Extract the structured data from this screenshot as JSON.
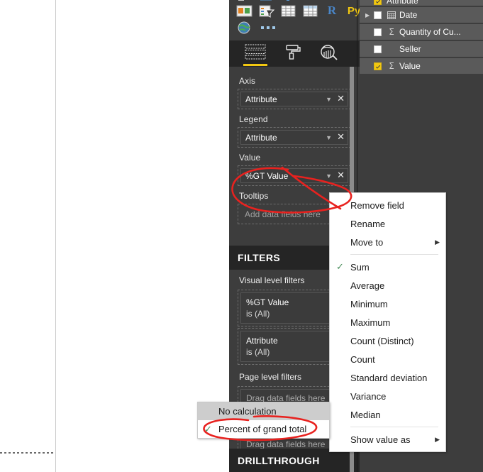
{
  "visualizations": {
    "gallery_icons": [
      "stacked-bar-chart-icon",
      "clustered-column-chart-icon",
      "line-chart-icon",
      "area-chart-icon",
      "card-icon",
      "slicer-funnel-icon",
      "table-icon",
      "matrix-icon",
      "r-script-visual-icon",
      "python-visual-icon",
      "map-globe-icon",
      "more-visuals-icon"
    ],
    "tabs": [
      {
        "name": "fields-tab",
        "label": "Fields",
        "active": true
      },
      {
        "name": "format-tab",
        "label": "Format",
        "active": false
      },
      {
        "name": "analytics-tab",
        "label": "Analytics",
        "active": false
      }
    ],
    "wells": [
      {
        "label": "Axis",
        "field": "Attribute",
        "placeholder": null
      },
      {
        "label": "Legend",
        "field": "Attribute",
        "placeholder": null
      },
      {
        "label": "Value",
        "field": "%GT Value",
        "placeholder": null
      },
      {
        "label": "Tooltips",
        "field": null,
        "placeholder": "Add data fields here"
      }
    ]
  },
  "filters": {
    "header": "FILTERS",
    "visual_level_label": "Visual level filters",
    "visual_filters": [
      {
        "name": "%GT Value",
        "value": "is (All)"
      },
      {
        "name": "Attribute",
        "value": "is (All)"
      }
    ],
    "page_level_label": "Page level filters",
    "page_level_placeholder": "Drag data fields here",
    "report_level_placeholder": "Drag data fields here",
    "drillthrough_header": "DRILLTHROUGH"
  },
  "fields": {
    "items": [
      {
        "label": "Attribute",
        "checked": true,
        "sigma": false,
        "calendar": false,
        "expandable": false,
        "clipped": true
      },
      {
        "label": "Date",
        "checked": false,
        "sigma": false,
        "calendar": true,
        "expandable": true,
        "clipped": false
      },
      {
        "label": "Quantity of Cu...",
        "checked": false,
        "sigma": true,
        "calendar": false,
        "expandable": false,
        "clipped": false
      },
      {
        "label": "Seller",
        "checked": false,
        "sigma": false,
        "calendar": false,
        "expandable": false,
        "clipped": false
      },
      {
        "label": "Value",
        "checked": true,
        "sigma": true,
        "calendar": false,
        "expandable": false,
        "clipped": false
      }
    ]
  },
  "context_menu": {
    "items": [
      {
        "label": "Remove field",
        "checked": false,
        "submenu": false,
        "separator_after": false
      },
      {
        "label": "Rename",
        "checked": false,
        "submenu": false,
        "separator_after": false
      },
      {
        "label": "Move to",
        "checked": false,
        "submenu": true,
        "separator_after": true
      },
      {
        "label": "Sum",
        "checked": true,
        "submenu": false,
        "separator_after": false
      },
      {
        "label": "Average",
        "checked": false,
        "submenu": false,
        "separator_after": false
      },
      {
        "label": "Minimum",
        "checked": false,
        "submenu": false,
        "separator_after": false
      },
      {
        "label": "Maximum",
        "checked": false,
        "submenu": false,
        "separator_after": false
      },
      {
        "label": "Count (Distinct)",
        "checked": false,
        "submenu": false,
        "separator_after": false
      },
      {
        "label": "Count",
        "checked": false,
        "submenu": false,
        "separator_after": false
      },
      {
        "label": "Standard deviation",
        "checked": false,
        "submenu": false,
        "separator_after": false
      },
      {
        "label": "Variance",
        "checked": false,
        "submenu": false,
        "separator_after": false
      },
      {
        "label": "Median",
        "checked": false,
        "submenu": false,
        "separator_after": true
      },
      {
        "label": "Show value as",
        "checked": false,
        "submenu": true,
        "separator_after": false
      }
    ]
  },
  "submenu": {
    "items": [
      {
        "label": "No calculation",
        "checked": false,
        "highlighted": true
      },
      {
        "label": "Percent of grand total",
        "checked": true,
        "highlighted": false
      }
    ]
  },
  "colors": {
    "accent_yellow": "#f2c811",
    "panel_dark": "#3d3d3d",
    "panel_darker": "#252525",
    "field_row": "#5a5a5a",
    "annotation_red": "#e8221f",
    "check_green": "#4a8f5c"
  }
}
